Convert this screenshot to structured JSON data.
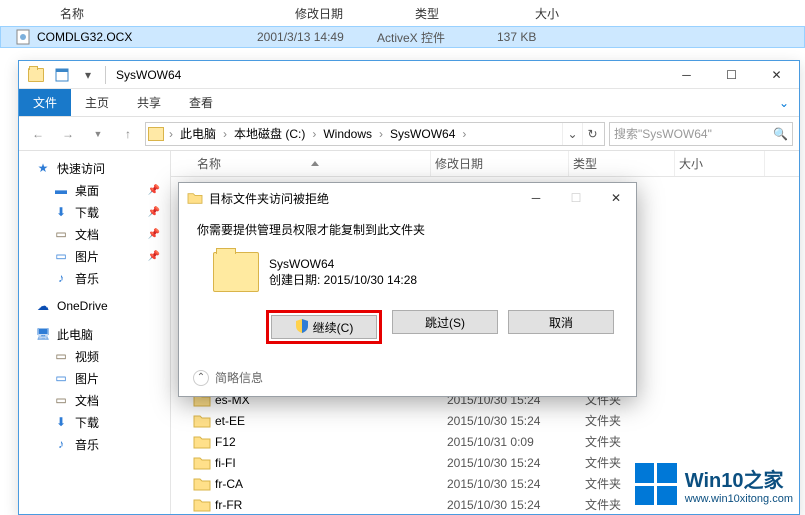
{
  "parent_window": {
    "columns": {
      "name": "名称",
      "date": "修改日期",
      "type": "类型",
      "size": "大小"
    },
    "row": {
      "name": "COMDLG32.OCX",
      "date": "2001/3/13 14:49",
      "type": "ActiveX 控件",
      "size": "137 KB"
    }
  },
  "explorer": {
    "title": "SysWOW64",
    "ribbon": {
      "file": "文件",
      "home": "主页",
      "share": "共享",
      "view": "查看"
    },
    "breadcrumb": [
      "此电脑",
      "本地磁盘 (C:)",
      "Windows",
      "SysWOW64"
    ],
    "search_placeholder": "搜索\"SysWOW64\"",
    "columns": {
      "name": "名称",
      "date": "修改日期",
      "type": "类型",
      "size": "大小"
    },
    "sidebar": {
      "quick_access": "快速访问",
      "items1": [
        "桌面",
        "下载",
        "文档",
        "图片",
        "音乐"
      ],
      "onedrive": "OneDrive",
      "this_pc": "此电脑",
      "items2": [
        "视频",
        "图片",
        "文档",
        "下载",
        "音乐"
      ]
    },
    "rows": [
      {
        "name": "es-MX",
        "date": "2015/10/30 15:24",
        "type": "文件夹"
      },
      {
        "name": "et-EE",
        "date": "2015/10/30 15:24",
        "type": "文件夹"
      },
      {
        "name": "F12",
        "date": "2015/10/31 0:09",
        "type": "文件夹"
      },
      {
        "name": "fi-FI",
        "date": "2015/10/30 15:24",
        "type": "文件夹"
      },
      {
        "name": "fr-CA",
        "date": "2015/10/30 15:24",
        "type": "文件夹"
      },
      {
        "name": "fr-FR",
        "date": "2015/10/30 15:24",
        "type": "文件夹"
      }
    ]
  },
  "dialog": {
    "title": "目标文件夹访问被拒绝",
    "message": "你需要提供管理员权限才能复制到此文件夹",
    "folder_name": "SysWOW64",
    "created": "创建日期: 2015/10/30 14:28",
    "continue_btn": "继续(C)",
    "skip_btn": "跳过(S)",
    "cancel_btn": "取消",
    "details": "简略信息"
  },
  "watermark": {
    "brand": "Win10之家",
    "url": "www.win10xitong.com"
  }
}
